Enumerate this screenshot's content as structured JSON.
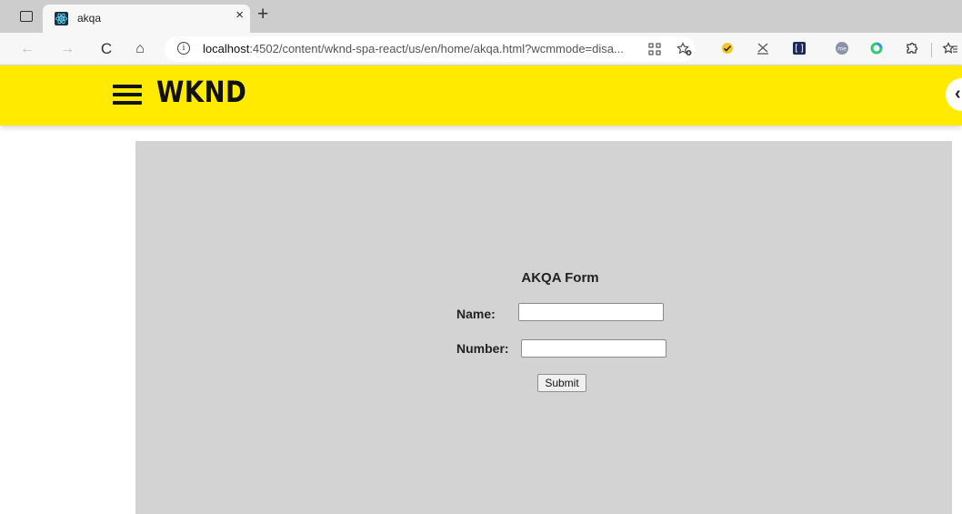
{
  "browser": {
    "tab": {
      "title": "akqa",
      "close_glyph": "×"
    },
    "new_tab_glyph": "+",
    "nav": {
      "back": "←",
      "forward": "→",
      "reload": "C",
      "home": "⌂"
    },
    "address": {
      "host": "localhost",
      "path": ":4502/content/wknd-spa-react/us/en/home/akqa.html?wcmmode=disa..."
    },
    "icons": [
      "tab-actions-icon",
      "react-favicon-icon",
      "info-icon",
      "app-grid-icon",
      "add-favorite-icon",
      "check-extension-icon",
      "x-extension-icon",
      "bracket-extension-icon",
      "me-extension-icon",
      "q-extension-icon",
      "extensions-puzzle-icon",
      "favorites-icon"
    ],
    "colors": {
      "tabstrip": "#cdcdcd",
      "toolbar": "#f7f7f7"
    }
  },
  "site": {
    "logo": "WKND",
    "header_color": "#ffea00",
    "edge_button_glyph": "‹"
  },
  "form": {
    "title": "AKQA Form",
    "name_label": "Name:",
    "name_value": "",
    "number_label": "Number:",
    "number_value": "",
    "submit_label": "Submit",
    "background": "#d3d3d3"
  }
}
